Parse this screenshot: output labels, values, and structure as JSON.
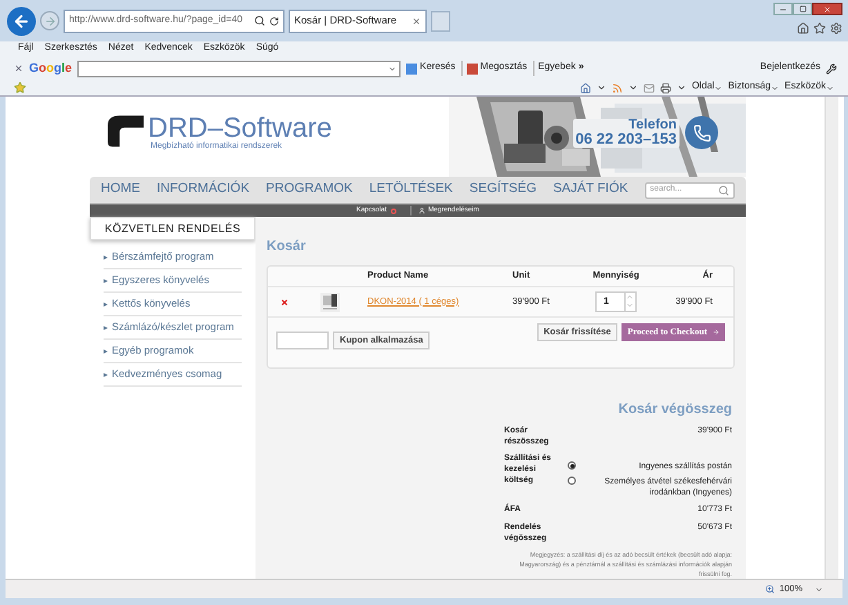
{
  "browser": {
    "address": "http://www.drd-software.hu/?page_id=40",
    "tab_title": "Kosár | DRD-Software",
    "menu": [
      "Fájl",
      "Szerkesztés",
      "Nézet",
      "Kedvencek",
      "Eszközök",
      "Súgó"
    ],
    "toolbar": {
      "brand": "Google",
      "search_button": "Keresés",
      "share_button": "Megosztás",
      "more_button": "Egyebek",
      "more_glyph": "»",
      "sign_in": "Bejelentkezés"
    },
    "command_bar": [
      "Oldal",
      "Biztonság",
      "Eszközök"
    ],
    "zoom": "100%"
  },
  "site": {
    "logo_title": "DRD–Software",
    "tagline": "Megbízható informatikai rendszerek",
    "phone_label": "Telefon",
    "phone": "06 22 203–153",
    "nav": [
      "HOME",
      "INFORMÁCIÓK",
      "PROGRAMOK",
      "LETÖLTÉSEK",
      "SEGÍTSÉG",
      "SAJÁT FIÓK"
    ],
    "search": {
      "placeholder": "search..."
    },
    "subnav": [
      "Kapcsolat",
      "Megrendeléseim"
    ]
  },
  "sidebar": {
    "title": "KÖZVETLEN RENDELÉS",
    "items": [
      "Bérszámfejtő program",
      "Egyszeres könyvelés",
      "Kettős könyvelés",
      "Számlázó/készlet program",
      "Egyéb programok",
      "Kedvezményes csomag"
    ]
  },
  "cart": {
    "title": "Kosár",
    "columns": [
      "Product Name",
      "Unit",
      "Mennyiség",
      "Ár"
    ],
    "rows": [
      {
        "product": "DKON-2014 ( 1 céges)",
        "unit": "39'900 Ft",
        "quantity": "1",
        "price": "39'900 Ft"
      }
    ],
    "coupon_button": "Kupon alkalmazása",
    "update_button": "Kosár frissítése",
    "checkout_button": "Proceed to Checkout"
  },
  "totals": {
    "title": "Kosár végösszeg",
    "rows": [
      {
        "kind": "value",
        "label": "Kosár részösszeg",
        "value": "39'900 Ft"
      },
      {
        "kind": "options",
        "label": "Szállítási és kezelési költség",
        "options": [
          {
            "label": "Ingyenes szállítás postán",
            "selected": true
          },
          {
            "label": "Személyes átvétel székesfehérvári irodánkban (Ingyenes)",
            "selected": false
          }
        ]
      },
      {
        "kind": "value",
        "label": "ÁFA",
        "value": "10'773 Ft"
      },
      {
        "kind": "value",
        "label": "Rendelés végösszeg",
        "value": "50'673 Ft"
      }
    ],
    "note": "Megjegyzés: a szállítási díj és az adó becsült értékek (becsült adó alapja: Magyarország) és a pénztárnál a szállítási és számlázási információk alapján frissülni fog."
  }
}
